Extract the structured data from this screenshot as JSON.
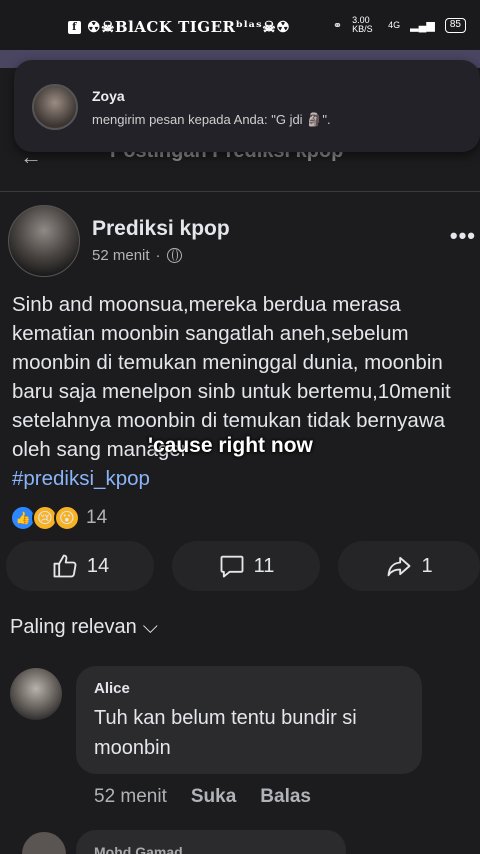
{
  "status_bar": {
    "carrier": "☢☠BlACK TIGERᵇˡᵃˢ☠☢",
    "network_speed": "3.00 KB/S",
    "network_type": "4G",
    "battery": "85"
  },
  "notification": {
    "sender": "Zoya",
    "message": "mengirim pesan kepada Anda: \"G jdi 🗿\"."
  },
  "page_header": {
    "title": "Postingan Prediksi kpop"
  },
  "post": {
    "author": "Prediksi kpop",
    "time": "52 menit",
    "body": "Sinb and moonsua,mereka berdua merasa kematian moonbin sangatlah aneh,sebelum moonbin di temukan meninggal dunia, moonbin baru saja menelpon sinb untuk bertemu,10menit setelahnya moonbin di temukan tidak bernyawa oleh sang manager",
    "hashtag": "#prediksi_kpop",
    "caption_overlay": "'cause right now",
    "reaction_count": "14",
    "like_count": "14",
    "comment_count": "11",
    "share_count": "1"
  },
  "comments_sort": {
    "label": "Paling relevan"
  },
  "comments": [
    {
      "author": "Alice",
      "text": "Tuh kan belum tentu bundir si moonbin",
      "time": "52 menit",
      "like_label": "Suka",
      "reply_label": "Balas"
    }
  ],
  "next_comment": {
    "author": "Mohd Gamad"
  },
  "icons": {
    "reactions": [
      "like",
      "sad",
      "wow"
    ]
  }
}
